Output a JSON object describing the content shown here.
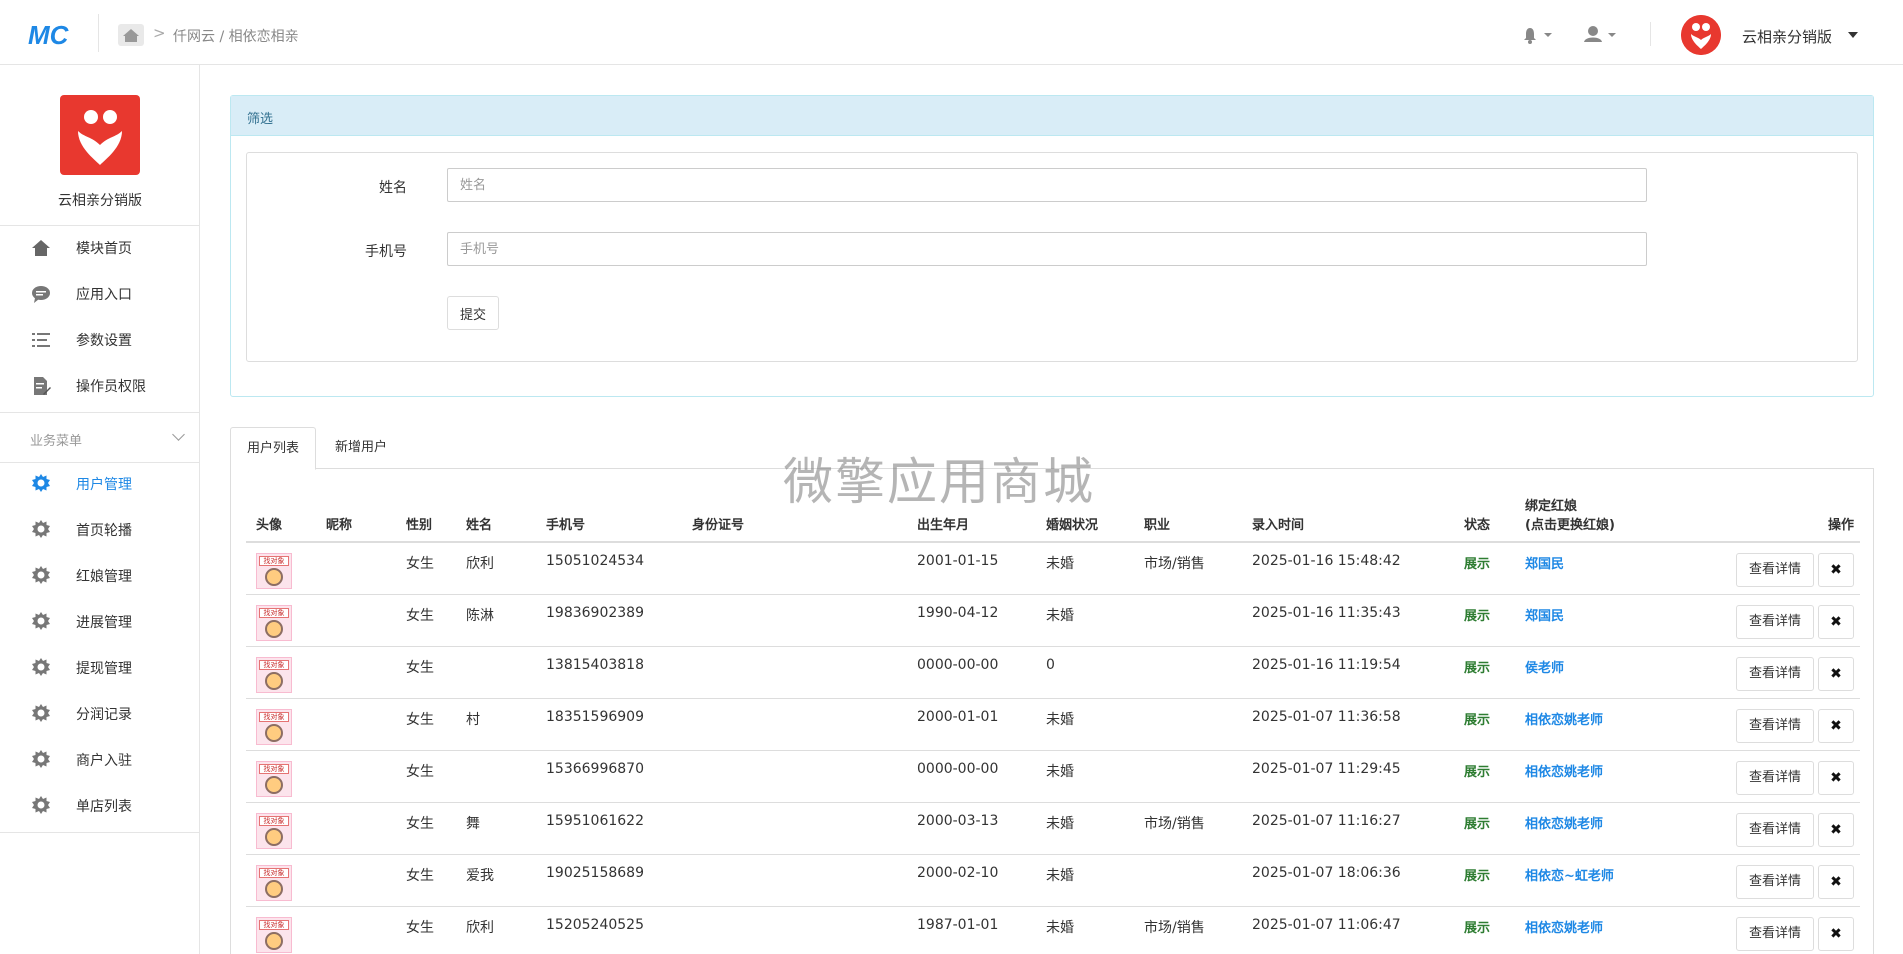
{
  "header": {
    "logo_text": "MC",
    "breadcrumb": "仟网云 / 相依恋相亲",
    "app_name": "云相亲分销版",
    "brand_color": "#1e88e5",
    "accent_red": "#e8382f"
  },
  "sidebar": {
    "title": "云相亲分销版",
    "top_items": [
      {
        "label": "模块首页",
        "icon": "home-icon"
      },
      {
        "label": "应用入口",
        "icon": "chat-icon"
      },
      {
        "label": "参数设置",
        "icon": "list-icon"
      },
      {
        "label": "操作员权限",
        "icon": "edit-doc-icon"
      }
    ],
    "section_title": "业务菜单",
    "biz_items": [
      {
        "label": "用户管理",
        "icon": "gear-icon",
        "active": true
      },
      {
        "label": "首页轮播",
        "icon": "gear-icon"
      },
      {
        "label": "红娘管理",
        "icon": "gear-icon"
      },
      {
        "label": "进展管理",
        "icon": "gear-icon"
      },
      {
        "label": "提现管理",
        "icon": "gear-icon"
      },
      {
        "label": "分润记录",
        "icon": "gear-icon"
      },
      {
        "label": "商户入驻",
        "icon": "gear-icon"
      },
      {
        "label": "单店列表",
        "icon": "gear-icon"
      }
    ]
  },
  "filter": {
    "title": "筛选",
    "name_label": "姓名",
    "name_placeholder": "姓名",
    "phone_label": "手机号",
    "phone_placeholder": "手机号",
    "submit_label": "提交"
  },
  "tabs": [
    "用户列表",
    "新增用户"
  ],
  "watermark": "微擎应用商城",
  "table": {
    "headers": {
      "avatar": "头像",
      "nickname": "昵称",
      "gender": "性别",
      "name": "姓名",
      "phone": "手机号",
      "idcard": "身份证号",
      "birth": "出生年月",
      "marital": "婚姻状况",
      "job": "职业",
      "created": "录入时间",
      "status": "状态",
      "hn_line1": "绑定红娘",
      "hn_line2": "(点击更换红娘)",
      "ops": "操作"
    },
    "avatar_tag": "找对象",
    "detail_label": "查看详情",
    "delete_label": "✖",
    "rows": [
      {
        "gender": "女生",
        "name": "欣利",
        "phone": "15051024534",
        "birth": "2001-01-15",
        "marital": "未婚",
        "job": "市场/销售",
        "created": "2025-01-16 15:48:42",
        "status": "展示",
        "hn": "郑国民"
      },
      {
        "gender": "女生",
        "name": "陈淋",
        "phone": "19836902389",
        "birth": "1990-04-12",
        "marital": "未婚",
        "job": "",
        "created": "2025-01-16 11:35:43",
        "status": "展示",
        "hn": "郑国民"
      },
      {
        "gender": "女生",
        "name": "",
        "phone": "13815403818",
        "birth": "0000-00-00",
        "marital": "0",
        "job": "",
        "created": "2025-01-16 11:19:54",
        "status": "展示",
        "hn": "侯老师"
      },
      {
        "gender": "女生",
        "name": "村",
        "phone": "18351596909",
        "birth": "2000-01-01",
        "marital": "未婚",
        "job": "",
        "created": "2025-01-07 11:36:58",
        "status": "展示",
        "hn": "相依恋姚老师"
      },
      {
        "gender": "女生",
        "name": "",
        "phone": "15366996870",
        "birth": "0000-00-00",
        "marital": "未婚",
        "job": "",
        "created": "2025-01-07 11:29:45",
        "status": "展示",
        "hn": "相依恋姚老师"
      },
      {
        "gender": "女生",
        "name": "舞",
        "phone": "15951061622",
        "birth": "2000-03-13",
        "marital": "未婚",
        "job": "市场/销售",
        "created": "2025-01-07 11:16:27",
        "status": "展示",
        "hn": "相依恋姚老师"
      },
      {
        "gender": "女生",
        "name": "爱我",
        "phone": "19025158689",
        "birth": "2000-02-10",
        "marital": "未婚",
        "job": "",
        "created": "2025-01-07 18:06:36",
        "status": "展示",
        "hn": "相依恋~虹老师"
      },
      {
        "gender": "女生",
        "name": "欣利",
        "phone": "15205240525",
        "birth": "1987-01-01",
        "marital": "未婚",
        "job": "市场/销售",
        "created": "2025-01-07 11:06:47",
        "status": "展示",
        "hn": "相依恋姚老师"
      }
    ]
  }
}
